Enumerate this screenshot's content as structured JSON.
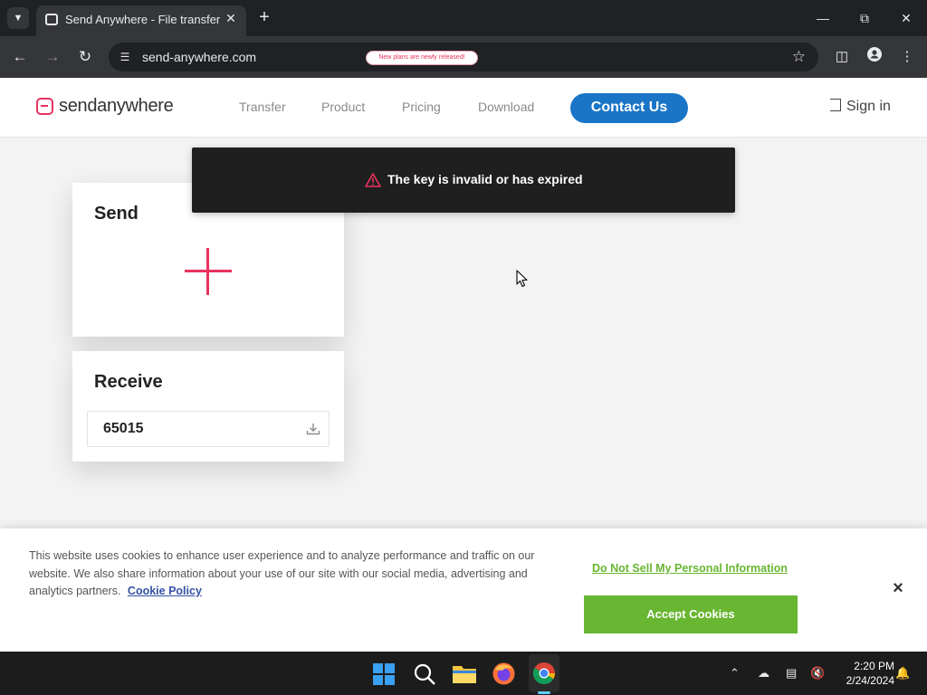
{
  "browser": {
    "tab_title": "Send Anywhere - File transfer",
    "url": "send-anywhere.com",
    "icons": {
      "tab_menu": "chevron-down-icon",
      "new_tab": "plus-icon",
      "minimize": "minimize-icon",
      "restore": "restore-icon",
      "close": "close-icon",
      "back": "arrow-left-icon",
      "forward": "arrow-right-icon",
      "reload": "reload-icon",
      "site_info": "tune-icon",
      "bookmark": "star-icon",
      "side_panel": "side-panel-icon",
      "profile": "profile-icon",
      "menu": "kebab-menu-icon"
    }
  },
  "header": {
    "logo_text": "sendanywhere",
    "nav": [
      "Transfer",
      "Product",
      "Pricing",
      "Download"
    ],
    "promo": "New plans are newly released!",
    "contact_label": "Contact Us",
    "signin_label": "Sign in"
  },
  "toast": {
    "message": "The key is invalid or has expired"
  },
  "send_card": {
    "title": "Send"
  },
  "receive_card": {
    "title": "Receive",
    "key_value": "65015"
  },
  "cookie_banner": {
    "text": "This website uses cookies to enhance user experience and to analyze performance and traffic on our website. We also share information about your use of our site with our social media, advertising and analytics partners.",
    "policy_link": "Cookie Policy",
    "do_not_sell": "Do Not Sell My Personal Information",
    "accept_label": "Accept Cookies",
    "close_symbol": "×"
  },
  "taskbar": {
    "time": "2:20 PM",
    "date": "2/24/2024"
  },
  "colors": {
    "brand_pink": "#e8335f",
    "contact_blue": "#1a75c7",
    "accept_green": "#68b631",
    "policy_blue": "#3451a3",
    "toast_bg": "#1f1f1f"
  }
}
